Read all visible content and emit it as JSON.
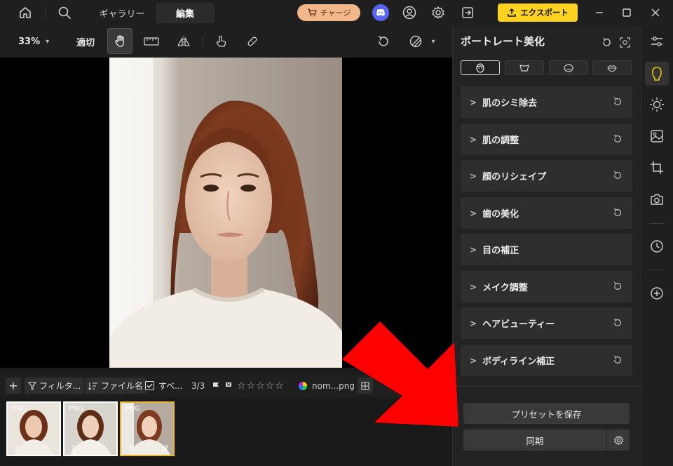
{
  "titlebar": {
    "tabs": [
      {
        "label": "ギャラリー",
        "active": false
      },
      {
        "label": "編集",
        "active": true
      }
    ],
    "charge_label": "チャージ",
    "export_label": "エクスポート"
  },
  "toolbar": {
    "zoom": "33%",
    "fit_label": "適切"
  },
  "filterbar": {
    "filter_label": "フィルタ...",
    "filename_label": "ファイル名",
    "select_all_label": "すべ...",
    "count": "3/3",
    "filename_filter": "nom...png"
  },
  "filmstrip": [
    {
      "badge": "PNG",
      "number": "1",
      "active": false
    },
    {
      "badge": "PNG",
      "number": "2",
      "active": false
    },
    {
      "badge": "PNG",
      "number": "3",
      "active": true
    }
  ],
  "panel": {
    "title": "ポートレート美化",
    "sections": [
      {
        "label": "肌のシミ除去",
        "has_reset": true
      },
      {
        "label": "肌の調整",
        "has_reset": true
      },
      {
        "label": "顔のリシェイプ",
        "has_reset": true
      },
      {
        "label": "歯の美化",
        "has_reset": true
      },
      {
        "label": "目の補正",
        "has_reset": false
      },
      {
        "label": "メイク調整",
        "has_reset": true
      },
      {
        "label": "ヘアビューティー",
        "has_reset": true
      },
      {
        "label": "ボディライン補正",
        "has_reset": true
      }
    ],
    "preset_label": "プリセットを保存",
    "sync_label": "同期"
  },
  "colors": {
    "accent": "#ffd21f",
    "charge": "#f2b88a",
    "active_thumb_border": "#e8b930",
    "annotation_arrow": "#ff0000"
  }
}
